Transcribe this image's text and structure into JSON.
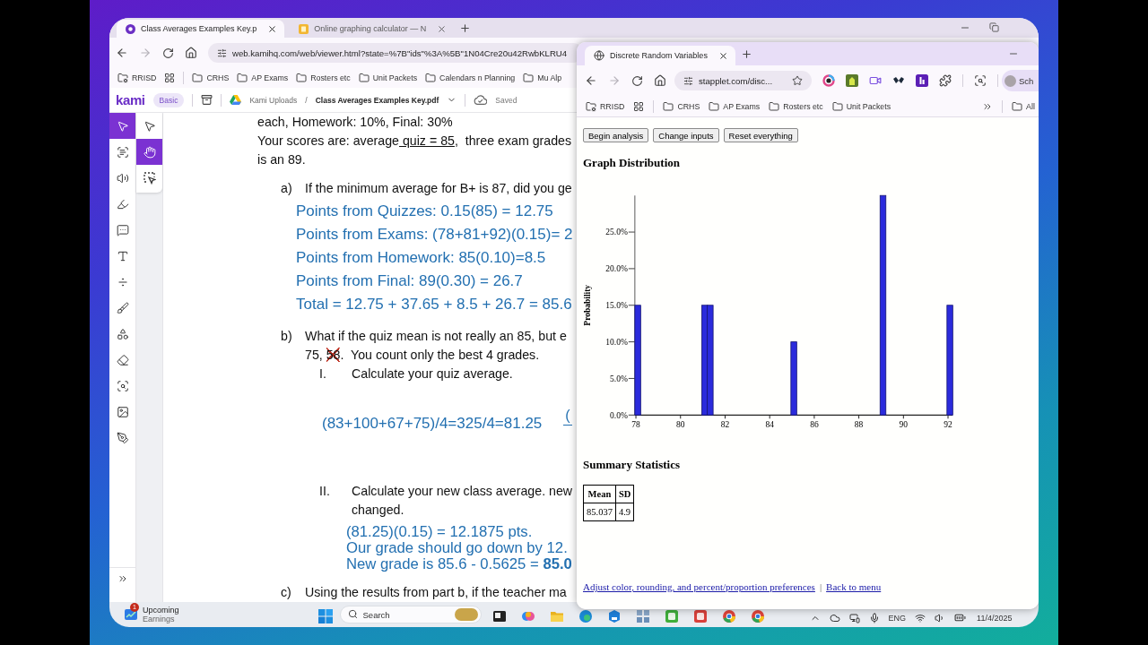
{
  "left_window": {
    "tabs": [
      {
        "title": "Class Averages Examples Key.p",
        "kind": "kami",
        "selected": true
      },
      {
        "title": "Online graphing calculator — N",
        "kind": "notebook",
        "selected": false
      }
    ],
    "url": "web.kamihq.com/web/viewer.html?state=%7B\"ids\"%3A%5B\"1N04Cre20u42RwbKLRU4",
    "bookmarks": [
      {
        "kind": "managed",
        "label": "RRISD"
      },
      {
        "kind": "apps"
      },
      {
        "kind": "folder",
        "label": "CRHS"
      },
      {
        "kind": "folder",
        "label": "AP Exams"
      },
      {
        "kind": "folder",
        "label": "Rosters etc"
      },
      {
        "kind": "folder",
        "label": "Unit Packets"
      },
      {
        "kind": "folder",
        "label": "Calendars n Planning"
      },
      {
        "kind": "folder",
        "label": "Mu Alp"
      }
    ],
    "kami_bar": {
      "logo": "kami",
      "plan": "Basic",
      "folder": "Kami Uploads",
      "separator": "/",
      "file": "Class Averages Examples Key.pdf",
      "status": "Saved"
    },
    "tools": [
      {
        "kind": "pointer",
        "selected": true
      },
      {
        "kind": "dictionary",
        "selected": false
      },
      {
        "kind": "speech",
        "selected": false
      },
      {
        "kind": "highlighter",
        "selected": false
      },
      {
        "kind": "comment",
        "selected": false
      },
      {
        "kind": "text",
        "selected": false
      },
      {
        "kind": "equation",
        "selected": false
      },
      {
        "kind": "brush",
        "selected": false
      },
      {
        "kind": "shapes",
        "selected": false
      },
      {
        "kind": "eraser",
        "selected": false
      },
      {
        "kind": "search",
        "selected": false
      },
      {
        "kind": "image",
        "selected": false
      },
      {
        "kind": "signature",
        "selected": false
      }
    ],
    "view_tools": [
      {
        "kind": "select",
        "selected": false
      },
      {
        "kind": "pan",
        "selected": true
      },
      {
        "kind": "area",
        "selected": false
      }
    ],
    "document": {
      "intro": [
        "each, Homework: 10%, Final: 30%",
        {
          "segments": [
            {
              "text": "Your scores are: average",
              "underline": false
            },
            {
              "text": " quiz = 85",
              "underline": true
            },
            {
              "text": ",  three exam grades",
              "underline": false
            }
          ]
        },
        "is an 89."
      ],
      "parts": [
        {
          "marker": "a)",
          "question": [
            "If the minimum average for B+ is 87, did you ge"
          ],
          "answers": {
            "kind": "paragraphs",
            "lines": [
              "Points from Quizzes: 0.15(85) = 12.75",
              "Points from Exams: (78+81+92)(0.15)= 2",
              "Points from Homework: 85(0.10)=8.5",
              "Points from Final: 89(0.30) = 26.7",
              "Total = 12.75 + 37.65 + 8.5 + 26.7 = 85.6"
            ]
          }
        },
        {
          "marker": "b)",
          "question": [
            "What if the quiz mean is not really an 85, but e",
            {
              "segments": [
                {
                  "text": "75, ",
                  "struck": false
                },
                {
                  "text": "58",
                  "struck": true
                },
                {
                  "text": ".  You count only the best 4 grades.",
                  "struck": false
                }
              ]
            }
          ],
          "subparts": [
            {
              "marker": "I.",
              "question": [
                "Calculate your quiz average."
              ],
              "answers": {
                "kind": "paragraphs",
                "lines": [
                  "(83+100+67+75)/4=325/4=81.25"
                ],
                "aside": "("
              }
            },
            {
              "marker": "II.",
              "question": [
                "Calculate your new class average. new",
                "changed."
              ],
              "answers": {
                "kind": "block",
                "lines": [
                  "(81.25)(0.15) = 12.1875 pts.",
                  "Our grade should go down by 12.",
                  "New grade is 85.6 - 0.5625 = **85.0**"
                ]
              }
            }
          ]
        },
        {
          "marker": "c)",
          "question": [
            "Using the results from part b, if the teacher ma"
          ]
        }
      ]
    }
  },
  "right_window": {
    "tabs": [
      {
        "title": "Discrete Random Variables",
        "kind": "web",
        "selected": true
      }
    ],
    "url": "stapplet.com/disc...",
    "profile": "Sch",
    "bookmarks": [
      {
        "kind": "managed",
        "label": "RRISD"
      },
      {
        "kind": "apps"
      },
      {
        "kind": "folder",
        "label": "CRHS"
      },
      {
        "kind": "folder",
        "label": "AP Exams"
      },
      {
        "kind": "folder",
        "label": "Rosters etc"
      },
      {
        "kind": "folder",
        "label": "Unit Packets"
      }
    ],
    "all_bookmarks": "All",
    "page": {
      "buttons": [
        "Begin analysis",
        "Change inputs",
        "Reset everything"
      ],
      "graph_heading": "Graph Distribution",
      "chart_data": {
        "type": "bar",
        "ylabel": "Probability",
        "x": [
          78,
          81,
          81.25,
          85,
          89,
          92
        ],
        "values": [
          15,
          15,
          15,
          10,
          30,
          15
        ],
        "xlim": [
          77.95,
          92.2
        ],
        "ylim": [
          0,
          30
        ],
        "xticks": [
          78,
          80,
          82,
          84,
          86,
          88,
          90,
          92
        ],
        "yticks": [
          {
            "value": 0,
            "label": "0.0%"
          },
          {
            "value": 5,
            "label": "5.0%"
          },
          {
            "value": 10,
            "label": "10.0%"
          },
          {
            "value": 15,
            "label": "15.0%"
          },
          {
            "value": 20,
            "label": "20.0%"
          },
          {
            "value": 25,
            "label": "25.0%"
          }
        ]
      },
      "summary_heading": "Summary Statistics",
      "summary_table": {
        "columns": [
          "Mean",
          "SD"
        ],
        "rows": [
          [
            "85.037",
            "4.9"
          ]
        ]
      },
      "links": [
        "Adjust color, rounding, and percent/proportion preferences",
        "Back to menu"
      ],
      "link_separator": "|"
    }
  },
  "taskbar": {
    "widget": {
      "title": "Upcoming",
      "subtitle": "Earnings",
      "badge": "1"
    },
    "search": {
      "placeholder": "Search"
    },
    "language": "ENG",
    "date": "11/4/2025"
  }
}
